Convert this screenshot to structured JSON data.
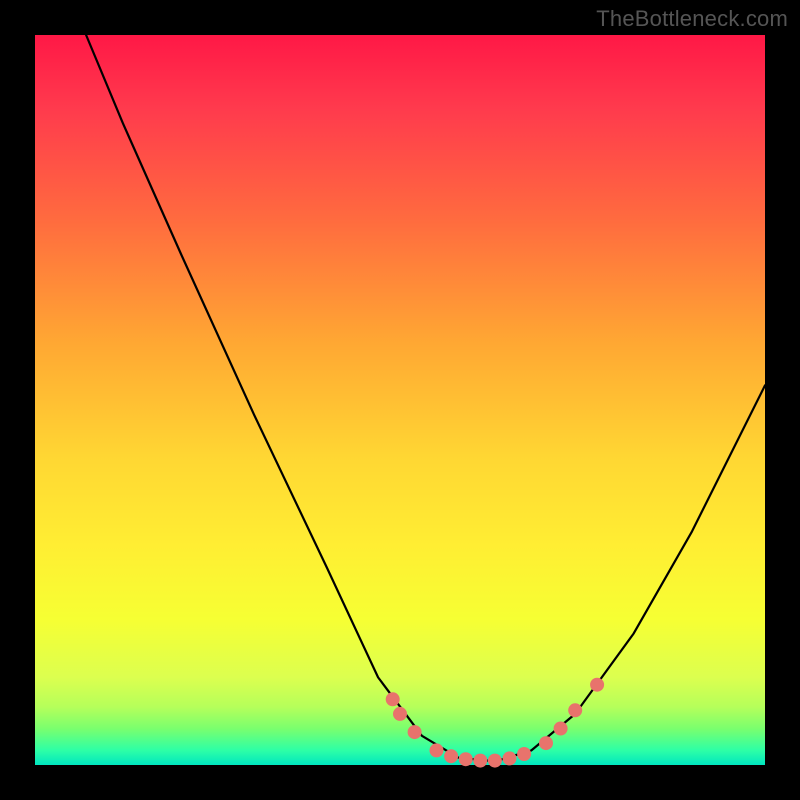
{
  "watermark": "TheBottleneck.com",
  "chart_data": {
    "type": "line",
    "title": "",
    "xlabel": "",
    "ylabel": "",
    "xlim": [
      0,
      100
    ],
    "ylim": [
      0,
      100
    ],
    "curve_points": [
      {
        "x": 7,
        "y": 100
      },
      {
        "x": 12,
        "y": 88
      },
      {
        "x": 20,
        "y": 70
      },
      {
        "x": 30,
        "y": 48
      },
      {
        "x": 40,
        "y": 27
      },
      {
        "x": 47,
        "y": 12
      },
      {
        "x": 53,
        "y": 4
      },
      {
        "x": 58,
        "y": 1
      },
      {
        "x": 63,
        "y": 0.5
      },
      {
        "x": 68,
        "y": 2
      },
      {
        "x": 74,
        "y": 7
      },
      {
        "x": 82,
        "y": 18
      },
      {
        "x": 90,
        "y": 32
      },
      {
        "x": 100,
        "y": 52
      }
    ],
    "markers": [
      {
        "x": 49,
        "y": 9
      },
      {
        "x": 50,
        "y": 7
      },
      {
        "x": 52,
        "y": 4.5
      },
      {
        "x": 55,
        "y": 2
      },
      {
        "x": 57,
        "y": 1.2
      },
      {
        "x": 59,
        "y": 0.8
      },
      {
        "x": 61,
        "y": 0.6
      },
      {
        "x": 63,
        "y": 0.6
      },
      {
        "x": 65,
        "y": 0.9
      },
      {
        "x": 67,
        "y": 1.5
      },
      {
        "x": 70,
        "y": 3
      },
      {
        "x": 72,
        "y": 5
      },
      {
        "x": 74,
        "y": 7.5
      },
      {
        "x": 77,
        "y": 11
      }
    ],
    "colors": {
      "gradient_top": "#ff1846",
      "gradient_mid": "#ffd733",
      "gradient_bottom": "#00e6c0",
      "curve": "#000000",
      "marker": "#e8736c",
      "background": "#000000"
    }
  }
}
